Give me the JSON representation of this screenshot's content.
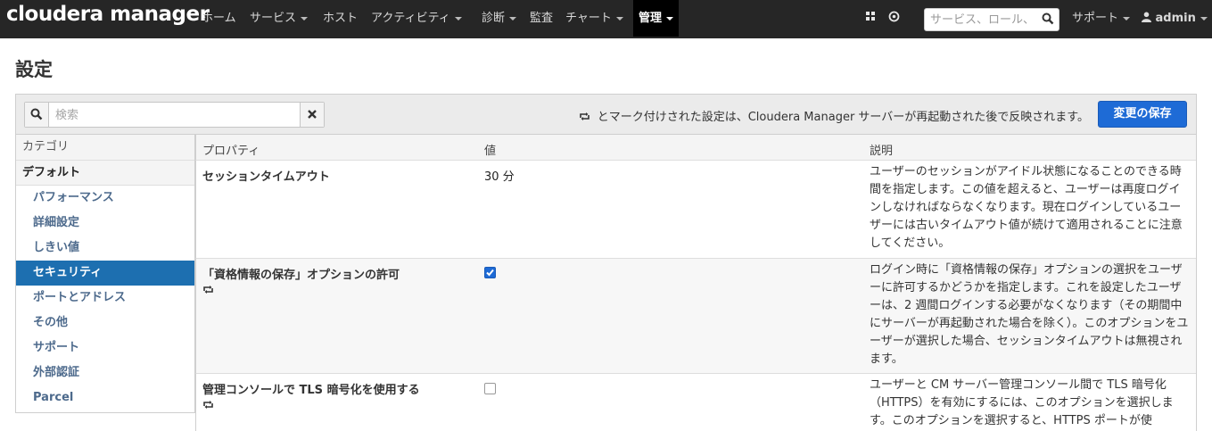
{
  "brand": "cloudera manager",
  "nav": {
    "home": "ホーム",
    "services": "サービス",
    "hosts": "ホスト",
    "activities": "アクティビティ",
    "diagnostics": "診断",
    "audits": "監査",
    "charts": "チャート",
    "admin": "管理",
    "search_placeholder": "サービス、ロール、",
    "support": "サポート",
    "user": "admin"
  },
  "page": {
    "title": "設定",
    "search_placeholder": "検索",
    "restart_note": "とマーク付けされた設定は、Cloudera Manager サーバーが再起動された後で反映されます。",
    "save_button": "変更の保存"
  },
  "sidebar": {
    "header": "カテゴリ",
    "default": "デフォルト",
    "items": [
      {
        "label": "パフォーマンス"
      },
      {
        "label": "詳細設定"
      },
      {
        "label": "しきい値"
      },
      {
        "label": "セキュリティ"
      },
      {
        "label": "ポートとアドレス"
      },
      {
        "label": "その他"
      },
      {
        "label": "サポート"
      },
      {
        "label": "外部認証"
      },
      {
        "label": "Parcel"
      }
    ],
    "active_index": 3
  },
  "table": {
    "headers": {
      "property": "プロパティ",
      "value": "値",
      "description": "説明"
    },
    "rows": [
      {
        "property": "セッションタイムアウト",
        "value": "30 分",
        "restart": false,
        "description": "ユーザーのセッションがアイドル状態になることのできる時間を指定します。この値を超えると、ユーザーは再度ログインしなければならなくなります。現在ログインしているユーザーには古いタイムアウト値が続けて適用されることに注意してください。"
      },
      {
        "property": "「資格情報の保存」オプションの許可",
        "checked": true,
        "restart": true,
        "description": "ログイン時に「資格情報の保存」オプションの選択をユーザーに許可するかどうかを指定します。これを設定したユーザーは、2 週間ログインする必要がなくなります（その期間中にサーバーが再起動された場合を除く）。このオプションをユーザーが選択した場合、セッションタイムアウトは無視されます。"
      },
      {
        "property": "管理コンソールで TLS 暗号化を使用する",
        "checked": false,
        "restart": true,
        "description": "ユーザーと CM サーバー管理コンソール間で TLS 暗号化（HTTPS）を有効にするには、このオプションを選択します。このオプションを選択すると、HTTPS ポートが使"
      }
    ]
  },
  "colors": {
    "navbar": "#262626",
    "primary": "#1e6bd6",
    "active_side": "#1d6fb0"
  }
}
